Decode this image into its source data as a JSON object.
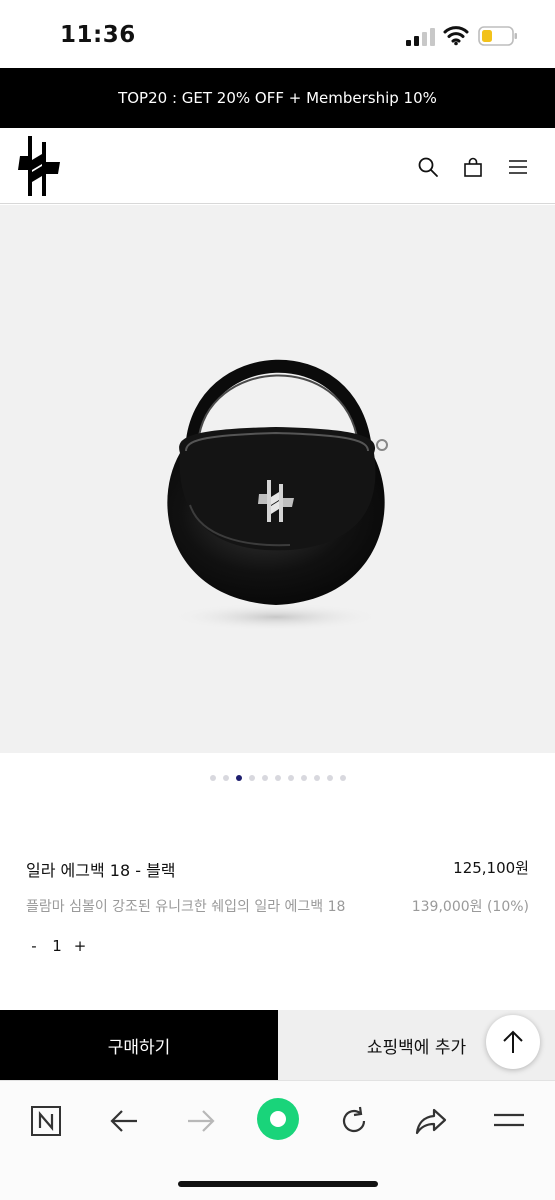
{
  "status_bar": {
    "time": "11:36",
    "icons": [
      "cellular-signal-icon",
      "wifi-icon",
      "battery-low-icon"
    ],
    "battery_color": "#f2c21b"
  },
  "promo": {
    "text": "TOP20 : GET 20% OFF + Membership 10%"
  },
  "header": {
    "logo": "plasma-symbol-logo",
    "icons": [
      "search-icon",
      "shopping-bag-icon",
      "menu-icon"
    ]
  },
  "gallery": {
    "image": "black-handbag-photo",
    "total_slides": 11,
    "active_slide": 3,
    "active_color": "#1e1e6e"
  },
  "product": {
    "name": "일라 에그백 18 - 블랙",
    "price": "125,100원",
    "description": "플람마 심볼이 강조된 유니크한 쉐입의 일라 에그백 18",
    "original_price": "139,000원 (10%)"
  },
  "quantity": {
    "minus": "-",
    "value": "1",
    "plus": "+"
  },
  "actions": {
    "buy_label": "구매하기",
    "cart_label": "쇼핑백에 추가"
  },
  "browser_toolbar": {
    "icons": [
      "naver-n-icon",
      "back-arrow-icon",
      "forward-arrow-icon",
      "green-dot-icon",
      "refresh-icon",
      "share-icon",
      "menu-icon"
    ],
    "accent": "#19d47a"
  }
}
